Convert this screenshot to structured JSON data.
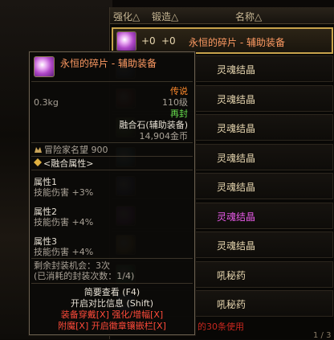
{
  "list": {
    "headers": {
      "enhance": "强化△",
      "forge": "锻造△",
      "name": "名称△"
    },
    "first_row": {
      "enhance": "+0",
      "forge": "+0",
      "name": "永恒的碎片 - 辅助装备"
    },
    "items": [
      {
        "name": "灵魂结晶",
        "name_color": "#e8d7b0",
        "icon_color": "#4a6aa8"
      },
      {
        "name": "灵魂结晶",
        "name_color": "#e8d7b0",
        "icon_color": "#a83a3a"
      },
      {
        "name": "灵魂结晶",
        "name_color": "#e8d7b0",
        "icon_color": "#6a9a3a"
      },
      {
        "name": "灵魂结晶",
        "name_color": "#e8d7b0",
        "icon_color": "#3a8aa8"
      },
      {
        "name": "灵魂结晶",
        "name_color": "#e8d7b0",
        "icon_color": "#5a5ab8"
      },
      {
        "name": "灵魂结晶",
        "name_color": "#e85ae8",
        "icon_color": "#b83ac8"
      },
      {
        "name": "灵魂结晶",
        "name_color": "#e8d7b0",
        "icon_color": "#c8a03a"
      },
      {
        "name": "吼秘药",
        "name_color": "#e8d7b0",
        "icon_color": "#3aa86a"
      },
      {
        "name": "吼秘药",
        "name_color": "#e8d7b0",
        "icon_color": "#3a7ac8"
      }
    ],
    "footer_text": "的30条使用",
    "page": "1 / 3"
  },
  "tooltip": {
    "title": "永恒的碎片 - 辅助装备",
    "weight": "0.3kg",
    "rarity": "传说",
    "level": "110级",
    "seal_state": "再封",
    "item_type": "融合石(辅助装备)",
    "price": "14,904金币",
    "adventure": "冒险家名望 900",
    "fusion_header": "<融合属性>",
    "attributes": [
      {
        "name": "属性1",
        "effect": "技能伤害 +3%"
      },
      {
        "name": "属性2",
        "effect": "技能伤害 +4%"
      },
      {
        "name": "属性3",
        "effect": "技能伤害 +4%"
      }
    ],
    "seal_chances": "剩余封装机会：3次",
    "seal_used": "(已消耗的封装次数：1/4)",
    "brief_view": "简要查看 (F4)",
    "compare": "开启对比信息 (Shift)",
    "actions_row1": "装备穿戴[X]  强化/增幅[X]",
    "actions_row2": "附魔[X]  开启徽章镶嵌栏[X]"
  }
}
